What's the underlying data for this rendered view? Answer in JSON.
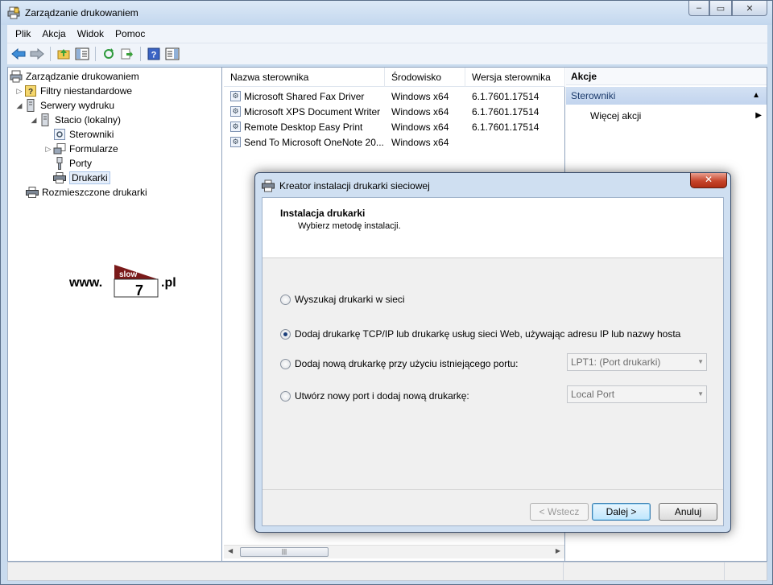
{
  "window": {
    "title": "Zarządzanie drukowaniem",
    "controls": {
      "minimize": "‒",
      "maximize": "▭",
      "close": "✕"
    }
  },
  "menu": [
    "Plik",
    "Akcja",
    "Widok",
    "Pomoc"
  ],
  "tree": {
    "root": "Zarządzanie drukowaniem",
    "filters": "Filtry niestandardowe",
    "servers": "Serwery wydruku",
    "server": "Stacio (lokalny)",
    "drivers": "Sterowniki",
    "forms": "Formularze",
    "ports": "Porty",
    "printers": "Drukarki",
    "deployed": "Rozmieszczone drukarki"
  },
  "watermark": {
    "www": "www.",
    "slow": "slow",
    "seven": "7",
    "pl": ".pl"
  },
  "list": {
    "columns": [
      "Nazwa sterownika",
      "Środowisko",
      "Wersja sterownika"
    ],
    "rows": [
      [
        "Microsoft Shared Fax Driver",
        "Windows x64",
        "6.1.7601.17514"
      ],
      [
        "Microsoft XPS Document Writer",
        "Windows x64",
        "6.1.7601.17514"
      ],
      [
        "Remote Desktop Easy Print",
        "Windows x64",
        "6.1.7601.17514"
      ],
      [
        "Send To Microsoft OneNote 20...",
        "Windows x64",
        ""
      ]
    ]
  },
  "actions": {
    "header": "Akcje",
    "section": "Sterowniki",
    "more": "Więcej akcji"
  },
  "dialog": {
    "title": "Kreator instalacji drukarki sieciowej",
    "heading": "Instalacja drukarki",
    "subheading": "Wybierz metodę instalacji.",
    "options": [
      {
        "label": "Wyszukaj drukarki w sieci",
        "checked": false
      },
      {
        "label": "Dodaj drukarkę TCP/IP lub drukarkę usług sieci Web, używając adresu IP lub nazwy hosta",
        "checked": true
      },
      {
        "label": "Dodaj nową drukarkę przy użyciu istniejącego portu:",
        "checked": false
      },
      {
        "label": "Utwórz nowy port i dodaj nową drukarkę:",
        "checked": false
      }
    ],
    "existing_port": "LPT1: (Port drukarki)",
    "new_port_type": "Local Port",
    "buttons": {
      "back": "< Wstecz",
      "next": "Dalej >",
      "cancel": "Anuluj"
    },
    "close": "✕"
  }
}
